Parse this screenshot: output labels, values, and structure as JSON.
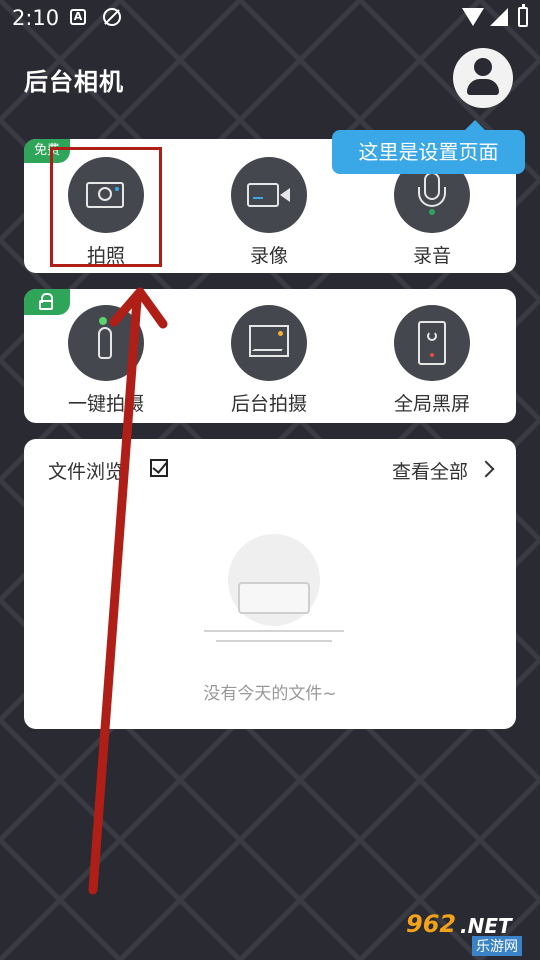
{
  "status_bar": {
    "time": "2:10"
  },
  "header": {
    "title": "后台相机"
  },
  "tooltip": {
    "text": "这里是设置页面"
  },
  "free_section": {
    "badge": "免费",
    "items": [
      {
        "label": "拍照",
        "icon": "camera-icon"
      },
      {
        "label": "录像",
        "icon": "video-camera-icon"
      },
      {
        "label": "录音",
        "icon": "microphone-icon"
      }
    ]
  },
  "locked_section": {
    "badge_icon": "unlock-icon",
    "items": [
      {
        "label": "一键拍摄",
        "icon": "finger-tap-icon"
      },
      {
        "label": "后台拍摄",
        "icon": "picture-icon"
      },
      {
        "label": "全局黑屏",
        "icon": "phone-power-icon"
      }
    ]
  },
  "files": {
    "title": "文件浏览",
    "view_all": "查看全部",
    "empty_text": "没有今天的文件~"
  },
  "watermark": {
    "num": "962",
    "net": ".NET",
    "sub": "乐游网"
  },
  "colors": {
    "background": "#2a2a33",
    "accent_green": "#2fa55a",
    "tooltip_blue": "#3aa7e6",
    "annotation_red": "#b01f17"
  }
}
